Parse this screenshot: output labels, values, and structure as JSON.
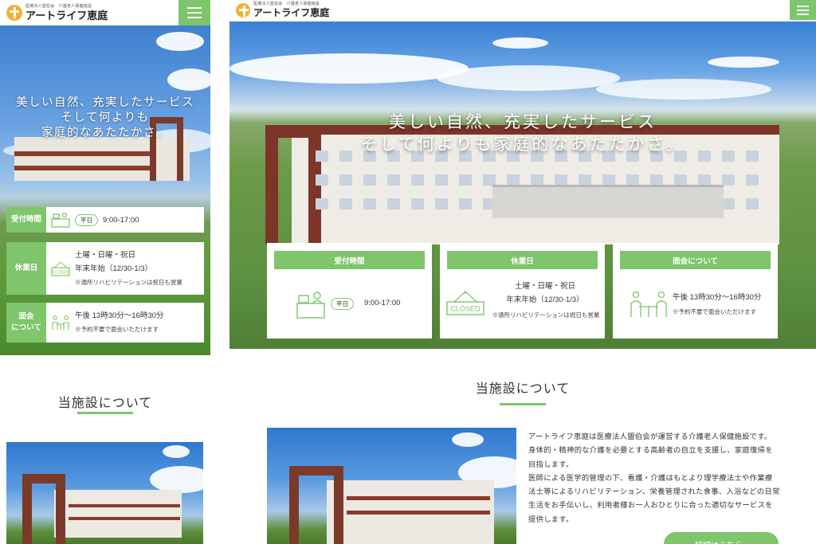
{
  "brand": {
    "small_text": "医療法人盟伯会　介護老人保健施設",
    "name": "アートライフ恵庭",
    "logo_color": "#f2b136"
  },
  "accent_color": "#7ec56b",
  "hero": {
    "mobile_lines": [
      "美しい自然、充実したサービス",
      "そして何よりも",
      "家庭的なあたたかさ。"
    ],
    "desktop_lines": [
      "美しい自然、充実したサービス",
      "そして何よりも家庭的なあたたかさ。"
    ]
  },
  "info": {
    "reception": {
      "label": "受付時間",
      "badge": "平日",
      "hours": "9:00-17:00"
    },
    "closed": {
      "label": "休業日",
      "sign": "CLOSED",
      "days": "土曜・日曜・祝日",
      "new_year": "年末年始（12/30-1/3）",
      "note": "※通所リハビリテーションは祝日も営業"
    },
    "visiting": {
      "label_mobile_line1": "面会",
      "label_mobile_line2": "について",
      "label": "面会について",
      "hours": "午後 13時30分〜16時30分",
      "note": "※予約不要で面会いただけます"
    }
  },
  "about": {
    "title": "当施設について",
    "paragraphs": [
      "アートライフ恵庭は医療法人盟伯会が運営する介護老人保健施設です。",
      "身体的・精神的な介護を必要とする高齢者の自立を支援し、家庭復帰を目指します。",
      "医師による医学的管理の下、看護・介護はもとより理学療法士や作業療法士等によるリハビリテーション、栄養管理された食事、入浴などの日常生活をお手伝いし、利用者様お一人おひとりに合った適切なサービスを提供します。"
    ],
    "detail_button": "詳細はこちら ›"
  },
  "icons": {
    "menu": "hamburger-icon",
    "reception": "reception-desk-icon",
    "closed": "closed-sign-icon",
    "visiting": "visiting-table-icon"
  }
}
